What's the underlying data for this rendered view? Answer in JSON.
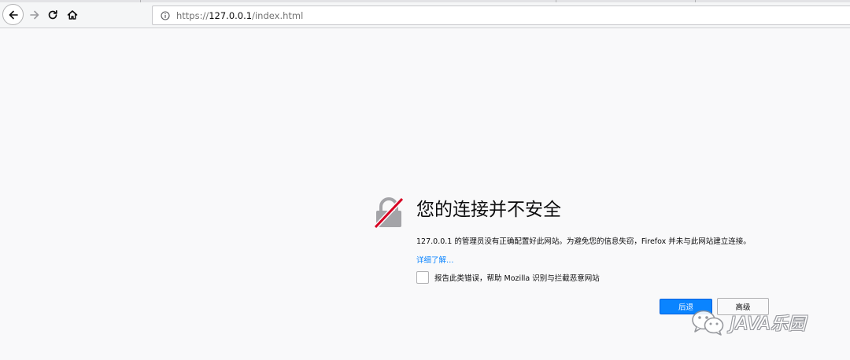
{
  "browser": {
    "url_scheme": "https://",
    "url_host": "127.0.0.1",
    "url_path": "/index.html"
  },
  "error": {
    "title": "您的连接并不安全",
    "description": "127.0.0.1 的管理员没有正确配置好此网站。为避免您的信息失窃，Firefox 并未与此网站建立连接。",
    "learn_more": "详细了解…",
    "report_label": "报告此类错误，帮助 Mozilla 识别与拦截恶意网站",
    "go_back_label": "后退",
    "advanced_label": "高级"
  },
  "watermark": {
    "text": "JAVA乐园"
  },
  "colors": {
    "accent": "#0a84ff",
    "page_bg": "#f9f9fa",
    "warning_red": "#d70022"
  }
}
